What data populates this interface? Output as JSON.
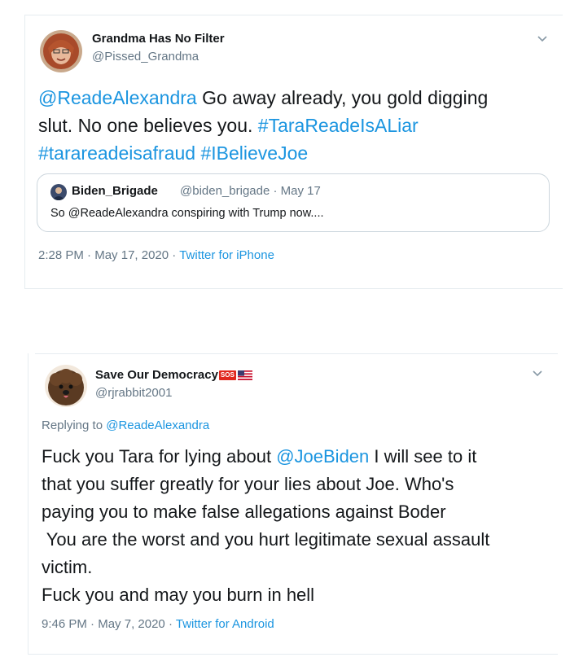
{
  "tweets": [
    {
      "display_name": "Grandma Has No Filter",
      "handle": "@Pissed_Grandma",
      "body": {
        "mention": "@ReadeAlexandra",
        "line1_rest": " Go away already, you gold digging",
        "line2_text": "slut. No one believes you. ",
        "hashtag1": "#TaraReadeIsALiar",
        "hashtag2": "#tarareadeisafraud",
        "hashtag3": "#IBelieveJoe"
      },
      "quote": {
        "name": "Biden_Brigade",
        "handle": "@biden_brigade",
        "separator": "·",
        "date": "May 17",
        "text": "So @ReadeAlexandra conspiring with Trump now...."
      },
      "time": "2:28 PM",
      "separator": "·",
      "date": "May 17, 2020",
      "source": "Twitter for iPhone"
    },
    {
      "display_name": "Save Our Democracy",
      "badge": "SOS",
      "handle": "@rjrabbit2001",
      "replying_prefix": "Replying to ",
      "replying_to": "@ReadeAlexandra",
      "body": {
        "line1_pre": "Fuck you Tara for lying about ",
        "mention": "@JoeBiden",
        "line1_post": " I will see to it",
        "line2": "that you suffer greatly for your lies about Joe. Who's",
        "line3": "paying you to make false allegations against Boder",
        "line4": " You are the worst and you hurt legitimate sexual assault",
        "line5": "victim.",
        "line6": "Fuck you and may you burn in hell"
      },
      "time": "9:46 PM",
      "separator": "·",
      "date": "May 7, 2020",
      "source": "Twitter for Android"
    }
  ],
  "icons": {
    "chevron": "chevron-down-icon",
    "flag": "us-flag-icon"
  },
  "colors": {
    "link": "#1b95e0",
    "muted": "#657786",
    "text": "#14171a",
    "border": "#e6ecf0"
  }
}
